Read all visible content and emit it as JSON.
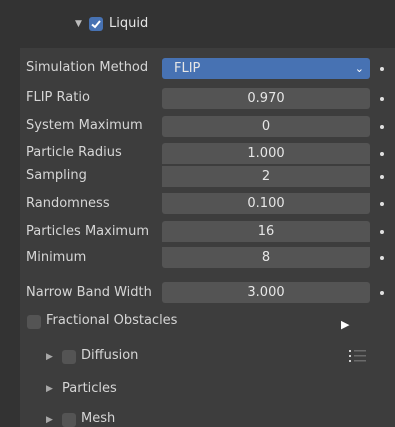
{
  "header": {
    "title": "Liquid",
    "enabled": true
  },
  "properties": {
    "simulation_method": {
      "label": "Simulation Method",
      "value": "FLIP"
    },
    "flip_ratio": {
      "label": "FLIP Ratio",
      "value": "0.970"
    },
    "system_maximum": {
      "label": "System Maximum",
      "value": "0"
    },
    "particle_radius": {
      "label": "Particle Radius",
      "value": "1.000"
    },
    "sampling": {
      "label": "Sampling",
      "value": "2"
    },
    "randomness": {
      "label": "Randomness",
      "value": "0.100"
    },
    "particles_maximum": {
      "label": "Particles Maximum",
      "value": "16"
    },
    "minimum": {
      "label": "Minimum",
      "value": "8"
    },
    "narrow_band_width": {
      "label": "Narrow Band Width",
      "value": "3.000"
    },
    "fractional_obstacles": {
      "label": "Fractional Obstacles",
      "checked": false
    }
  },
  "subpanels": [
    {
      "label": "Diffusion",
      "has_checkbox": true,
      "checked": false
    },
    {
      "label": "Particles",
      "has_checkbox": false
    },
    {
      "label": "Mesh",
      "has_checkbox": true,
      "checked": false
    }
  ],
  "icons": {
    "expand": "triangle-down",
    "collapsed": "triangle-right",
    "check": "checkmark",
    "play": "play-triangle",
    "list": "list-lines",
    "chevron": "chevron-down"
  },
  "colors": {
    "background": "#333333",
    "panel_body": "#3d3d3d",
    "field": "#545454",
    "accent": "#4772b3",
    "text": "#dcdcdc"
  }
}
